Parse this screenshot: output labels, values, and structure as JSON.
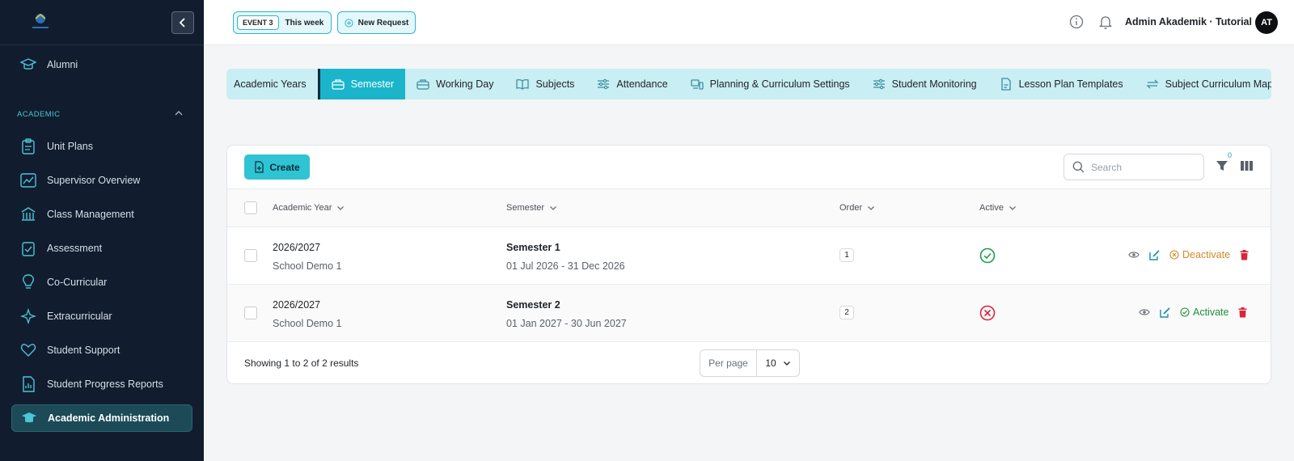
{
  "sidebar": {
    "items_top": [
      {
        "label": "Alumni",
        "icon": "graduation-cap-icon"
      }
    ],
    "section": {
      "label": "ACADEMIC"
    },
    "items": [
      {
        "label": "Unit Plans",
        "icon": "clipboard-icon"
      },
      {
        "label": "Supervisor Overview",
        "icon": "chart-icon"
      },
      {
        "label": "Class Management",
        "icon": "building-icon"
      },
      {
        "label": "Assessment",
        "icon": "clipboard-check-icon"
      },
      {
        "label": "Co-Curricular",
        "icon": "lightbulb-icon"
      },
      {
        "label": "Extracurricular",
        "icon": "sparkles-icon"
      },
      {
        "label": "Student Support",
        "icon": "heart-icon"
      },
      {
        "label": "Student Progress Reports",
        "icon": "report-icon"
      },
      {
        "label": "Academic Administration",
        "icon": "graduation-cap-icon",
        "active": true
      }
    ]
  },
  "topbar": {
    "event_badge": "EVENT 3",
    "event_week": "This week",
    "new_request": "New Request",
    "user_name": "Admin Akademik · Tutorial",
    "avatar_initials": "AT"
  },
  "tabs": [
    {
      "label": "Academic Years",
      "icon": ""
    },
    {
      "label": "Semester",
      "icon": "briefcase-icon",
      "active": true
    },
    {
      "label": "Working Day",
      "icon": "briefcase-icon"
    },
    {
      "label": "Subjects",
      "icon": "book-icon"
    },
    {
      "label": "Attendance",
      "icon": "sliders-icon"
    },
    {
      "label": "Planning & Curriculum Settings",
      "icon": "devices-icon"
    },
    {
      "label": "Student Monitoring",
      "icon": "sliders-icon"
    },
    {
      "label": "Lesson Plan Templates",
      "icon": "file-icon"
    },
    {
      "label": "Subject Curriculum Mappi",
      "icon": "swap-icon"
    }
  ],
  "toolbar": {
    "create_label": "Create",
    "search_placeholder": "Search",
    "filter_count": "0"
  },
  "table": {
    "headers": [
      "Academic Year",
      "Semester",
      "Order",
      "Active"
    ],
    "rows": [
      {
        "year": "2026/2027",
        "school": "School Demo 1",
        "semester": "Semester 1",
        "dates": "01 Jul 2026 - 31 Dec 2026",
        "order": "1",
        "active": true,
        "toggle_label": "Deactivate"
      },
      {
        "year": "2026/2027",
        "school": "School Demo 1",
        "semester": "Semester 2",
        "dates": "01 Jan 2027 - 30 Jun 2027",
        "order": "2",
        "active": false,
        "toggle_label": "Activate"
      }
    ]
  },
  "footer": {
    "showing": "Showing 1 to 2 of 2 results",
    "per_page_label": "Per page",
    "per_page_value": "10"
  },
  "colors": {
    "accent": "#2ec4d4",
    "sidebar_bg": "#111d2e",
    "success": "#1f9d4a",
    "danger": "#d9263a",
    "warning": "#d08a2a"
  }
}
